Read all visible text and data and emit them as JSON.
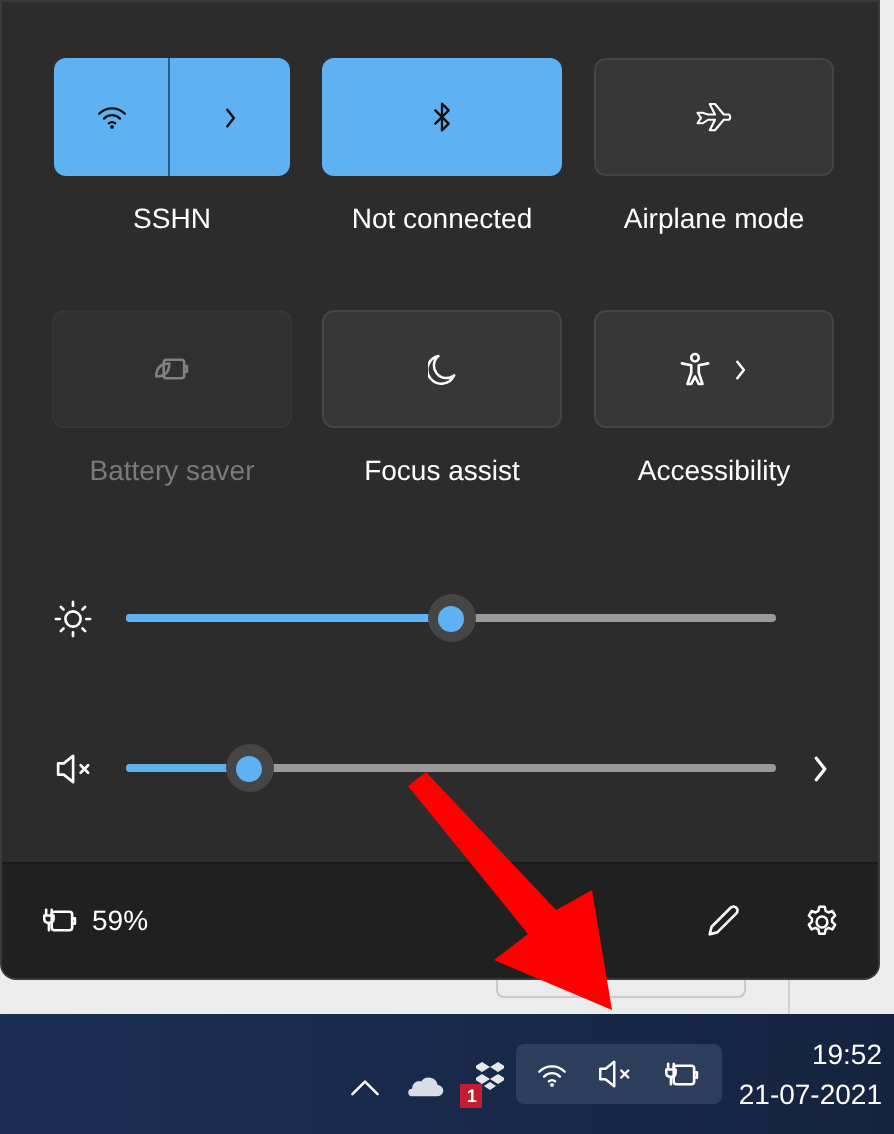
{
  "tiles": [
    {
      "label": "SSHN",
      "kind": "split",
      "on": true,
      "disabled": false
    },
    {
      "label": "Not connected",
      "kind": "toggle",
      "on": true,
      "disabled": false
    },
    {
      "label": "Airplane mode",
      "kind": "toggle",
      "on": false,
      "disabled": false
    },
    {
      "label": "Battery saver",
      "kind": "toggle",
      "on": false,
      "disabled": true
    },
    {
      "label": "Focus assist",
      "kind": "toggle",
      "on": false,
      "disabled": false
    },
    {
      "label": "Accessibility",
      "kind": "menu",
      "on": false,
      "disabled": false
    }
  ],
  "sliders": [
    {
      "kind": "brightness",
      "level": 0.5
    },
    {
      "kind": "volume",
      "level": 0.19,
      "muted": true
    }
  ],
  "battery": {
    "reading": "59%"
  },
  "taskbar": {
    "notification_badge": "1",
    "time": "19:52",
    "date": "21-07-2021"
  }
}
